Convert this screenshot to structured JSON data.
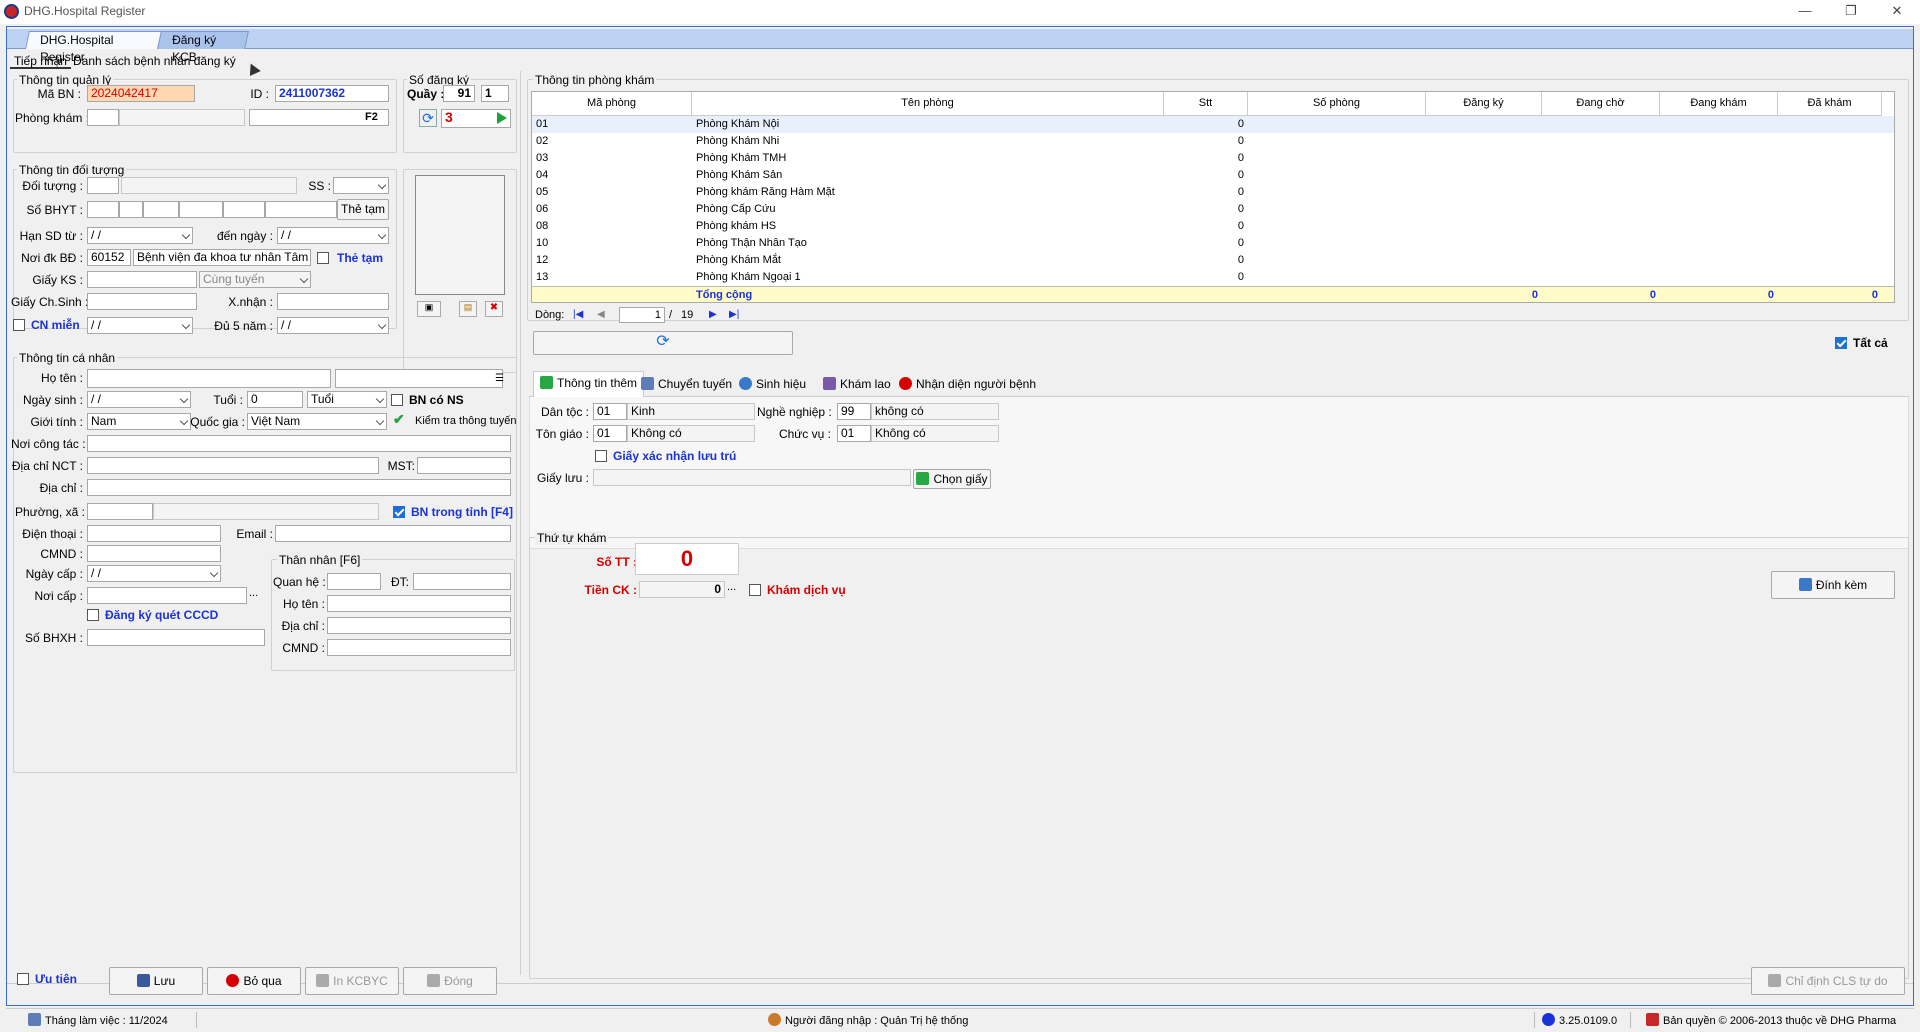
{
  "window": {
    "title": "DHG.Hospital Register",
    "minimize": "—",
    "maximize": "❐",
    "close": "✕"
  },
  "top_tabs": [
    "DHG.Hospital Register",
    "Đăng ký KCB"
  ],
  "sub_tabs": [
    "Tiếp nhận",
    "Danh sách bệnh nhân đăng ký"
  ],
  "quanly": {
    "title": "Thông tin quản lý",
    "ma_bn_label": "Mã BN :",
    "ma_bn": "2024042417",
    "id_label": "ID :",
    "id": "2411007362",
    "phong_kham_label": "Phòng khám :",
    "f2": "F2"
  },
  "sodangky": {
    "title": "Số đăng ký",
    "quay_label": "Quầy :",
    "quay": "91",
    "quay2": "1",
    "so": "3"
  },
  "doituong": {
    "title": "Thông tin đối tượng",
    "doi_tuong_label": "Đối tượng :",
    "ss_label": "SS :",
    "so_bhyt_label": "Số BHYT :",
    "the_tam_btn": "Thẻ tạm",
    "han_sd_label": "Hạn SD từ :",
    "date_blank": " /    / ",
    "den_ngay_label": "đến ngày :",
    "noi_dk_label": "Nơi đk BĐ :",
    "noi_dk_code": "60152",
    "noi_dk_name": "Bệnh viện đa khoa tư nhân Tâm Phúc",
    "the_tam_chk": "Thẻ tạm",
    "giay_ks_label": "Giấy KS :",
    "cung_tuyen": "Cùng tuyến",
    "giay_ch_label": "Giấy Ch.Sinh :",
    "xnhan_label": "X.nhận :",
    "cn_mien": "CN miễn",
    "du5nam_label": "Đủ 5 năm :"
  },
  "canhan": {
    "title": "Thông tin cá nhân",
    "ho_ten_label": "Họ tên :",
    "ngay_sinh_label": "Ngày sinh :",
    "tuoi_label": "Tuổi :",
    "tuoi": "0",
    "tuoi_unit": "Tuổi",
    "bn_co_ns": "BN có NS",
    "gioi_tinh_label": "Giới tính :",
    "gioi_tinh": "Nam",
    "quoc_gia_label": "Quốc gia :",
    "quoc_gia": "Việt Nam",
    "kiem_tra": "Kiểm tra thông tuyến",
    "noi_ct_label": "Nơi công tác :",
    "dia_chi_nct_label": "Địa chỉ NCT :",
    "mst_label": "MST:",
    "dia_chi_label": "Địa chỉ :",
    "phuong_xa_label": "Phường, xã :",
    "bn_trong_tinh": "BN trong tỉnh [F4]",
    "dien_thoai_label": "Điện thoại :",
    "email_label": "Email :",
    "cmnd_label": "CMND :",
    "ngay_cap_label": "Ngày cấp :",
    "noi_cap_label": "Nơi cấp :",
    "dang_ky_cccd": "Đăng ký quét CCCD",
    "so_bhxh_label": "Số BHXH :"
  },
  "thannhan": {
    "title": "Thân nhân [F6]",
    "quan_he_label": "Quan hệ :",
    "dt_label": "ĐT:",
    "ho_ten_label": "Họ tên :",
    "dia_chi_label": "Địa chỉ :",
    "cmnd_label": "CMND :"
  },
  "phongkham": {
    "title": "Thông tin phòng khám",
    "columns": [
      "Mã phòng",
      "Tên phòng",
      "Stt",
      "Số phòng",
      "Đăng ký",
      "Đang chờ",
      "Đang khám",
      "Đã khám"
    ],
    "rows": [
      [
        "01",
        "Phòng Khám Nội",
        "0"
      ],
      [
        "02",
        "Phòng Khám Nhi",
        "0"
      ],
      [
        "03",
        "Phòng Khám TMH",
        "0"
      ],
      [
        "04",
        "Phòng Khám Sản",
        "0"
      ],
      [
        "05",
        "Phòng khám Răng Hàm Mặt",
        "0"
      ],
      [
        "06",
        "Phòng Cấp Cứu",
        "0"
      ],
      [
        "08",
        "Phòng khám HS",
        "0"
      ],
      [
        "10",
        "Phòng Thận Nhân Tạo",
        "0"
      ],
      [
        "12",
        "Phòng Khám Mắt",
        "0"
      ],
      [
        "13",
        "Phòng Khám Ngoại 1",
        "0"
      ]
    ],
    "total_label": "Tổng cộng",
    "totals": [
      "0",
      "0",
      "0",
      "0"
    ],
    "dong_label": "Dòng:",
    "page": "1",
    "page_sep": "/",
    "page_total": "19",
    "tat_ca": "Tất cả"
  },
  "info_tabs": [
    "Thông tin thêm",
    "Chuyển tuyến",
    "Sinh hiệu",
    "Khám lao",
    "Nhận diện người bệnh"
  ],
  "thongtinthem": {
    "dan_toc_label": "Dân tộc :",
    "dan_toc_code": "01",
    "dan_toc": "Kinh",
    "nghe_nghiep_label": "Nghề nghiệp :",
    "nghe_nghiep_code": "99",
    "nghe_nghiep": "không có",
    "ton_giao_label": "Tôn giáo :",
    "ton_giao_code": "01",
    "ton_giao": "Không có",
    "chuc_vu_label": "Chức vụ :",
    "chuc_vu_code": "01",
    "chuc_vu": "Không có",
    "giay_xac_nhan": "Giấy xác nhận lưu trú",
    "giay_luu_label": "Giấy lưu :",
    "chon_giay": "Chọn giấy"
  },
  "thutu": {
    "title": "Thứ tự khám",
    "so_tt_label": "Số TT :",
    "so_tt": "0",
    "tien_ck_label": "Tiền CK :",
    "tien_ck": "0",
    "kham_dich_vu": "Khám dịch vụ",
    "dinh_kem": "Đính kèm"
  },
  "bottom": {
    "uu_tien": "Ưu tiên",
    "luu": "Lưu",
    "bo_qua": "Bỏ qua",
    "in_kcbyc": "In KCBYC",
    "dong": "Đóng",
    "chi_dinh": "Chỉ định CLS tự do"
  },
  "status": {
    "thang": "Tháng làm việc : 11/2024",
    "nguoi": "Người đăng nhập : Quản Trị hệ thống",
    "version": "3.25.0109.0",
    "ban_quyen": "Bản quyền © 2006-2013 thuộc về DHG Pharma"
  },
  "colors": {
    "accent": "#3a6bd0",
    "red": "#d60000",
    "blue": "#1a32d6",
    "total_row": "#fffbc8"
  }
}
